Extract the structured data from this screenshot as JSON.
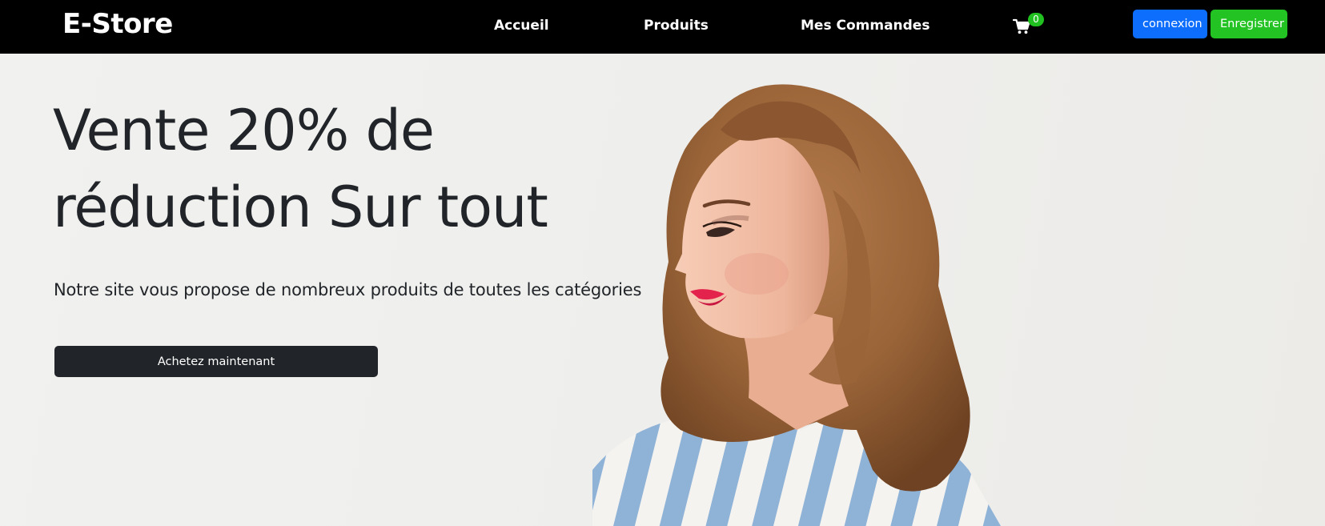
{
  "navbar": {
    "brand": "E-Store",
    "links": [
      "Accueil",
      "Produits",
      "Mes Commandes"
    ],
    "cart": {
      "icon": "cart-icon",
      "count": "0"
    },
    "login_label": "connexion",
    "register_label": "Enregistrer"
  },
  "hero": {
    "title": "Vente 20% de réduction Sur tout",
    "subtitle": "Notre site vous propose de nombreux produits de toutes les catégories",
    "cta_label": "Achetez maintenant",
    "image": "woman-portrait-striped-shirt"
  },
  "colors": {
    "navbar_bg": "#000000",
    "login_button": "#0d6efd",
    "register_button": "#22c322",
    "cart_badge": "#1fc01f",
    "cta_bg": "#212529",
    "hero_bg": "#efefed"
  }
}
